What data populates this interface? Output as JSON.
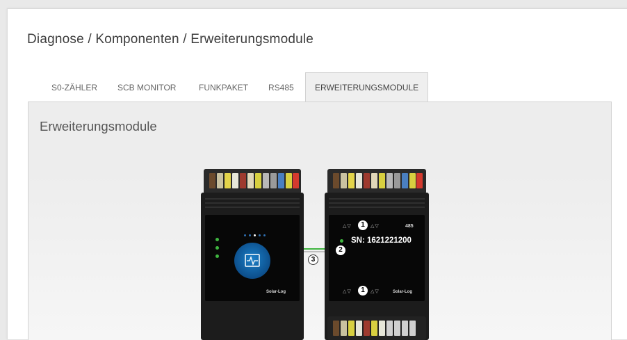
{
  "breadcrumb": "Diagnose / Komponenten / Erweiterungsmodule",
  "tabs": [
    {
      "label": "S0-ZÄHLER"
    },
    {
      "label": "SCB MONITOR"
    },
    {
      "label": "FUNKPAKET"
    },
    {
      "label": "RS485"
    },
    {
      "label": "ERWEITERUNGSMODULE"
    }
  ],
  "panel": {
    "title": "Erweiterungsmodule"
  },
  "module": {
    "port_label": "485",
    "serial": "SN: 1621221200",
    "brand": "Solar-Log",
    "callouts": [
      "1",
      "2",
      "3",
      "1"
    ]
  },
  "colors": {
    "led": "#3fb540",
    "icon": "#1a7fc8",
    "active_tab_bg": "#efefef"
  }
}
